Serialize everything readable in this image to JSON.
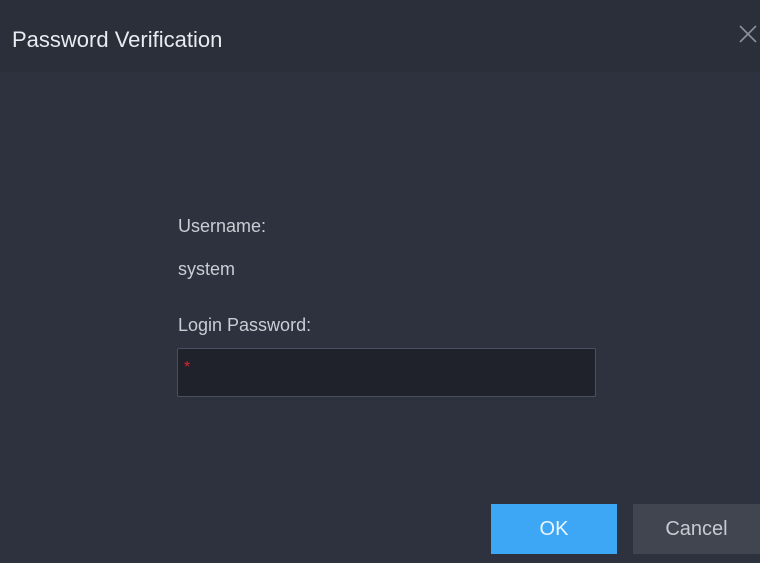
{
  "dialog": {
    "title": "Password Verification",
    "close_icon": "close-icon"
  },
  "form": {
    "username_label": "Username:",
    "username_value": "system",
    "password_label": "Login Password:",
    "password_value": "",
    "password_required_mark": "*"
  },
  "buttons": {
    "ok_label": "OK",
    "cancel_label": "Cancel"
  },
  "colors": {
    "dialog_background": "#2d323e",
    "input_background": "#1f222b",
    "ok_button": "#3ea7f5",
    "cancel_button": "#40454f",
    "required_mark": "#e0242c"
  }
}
